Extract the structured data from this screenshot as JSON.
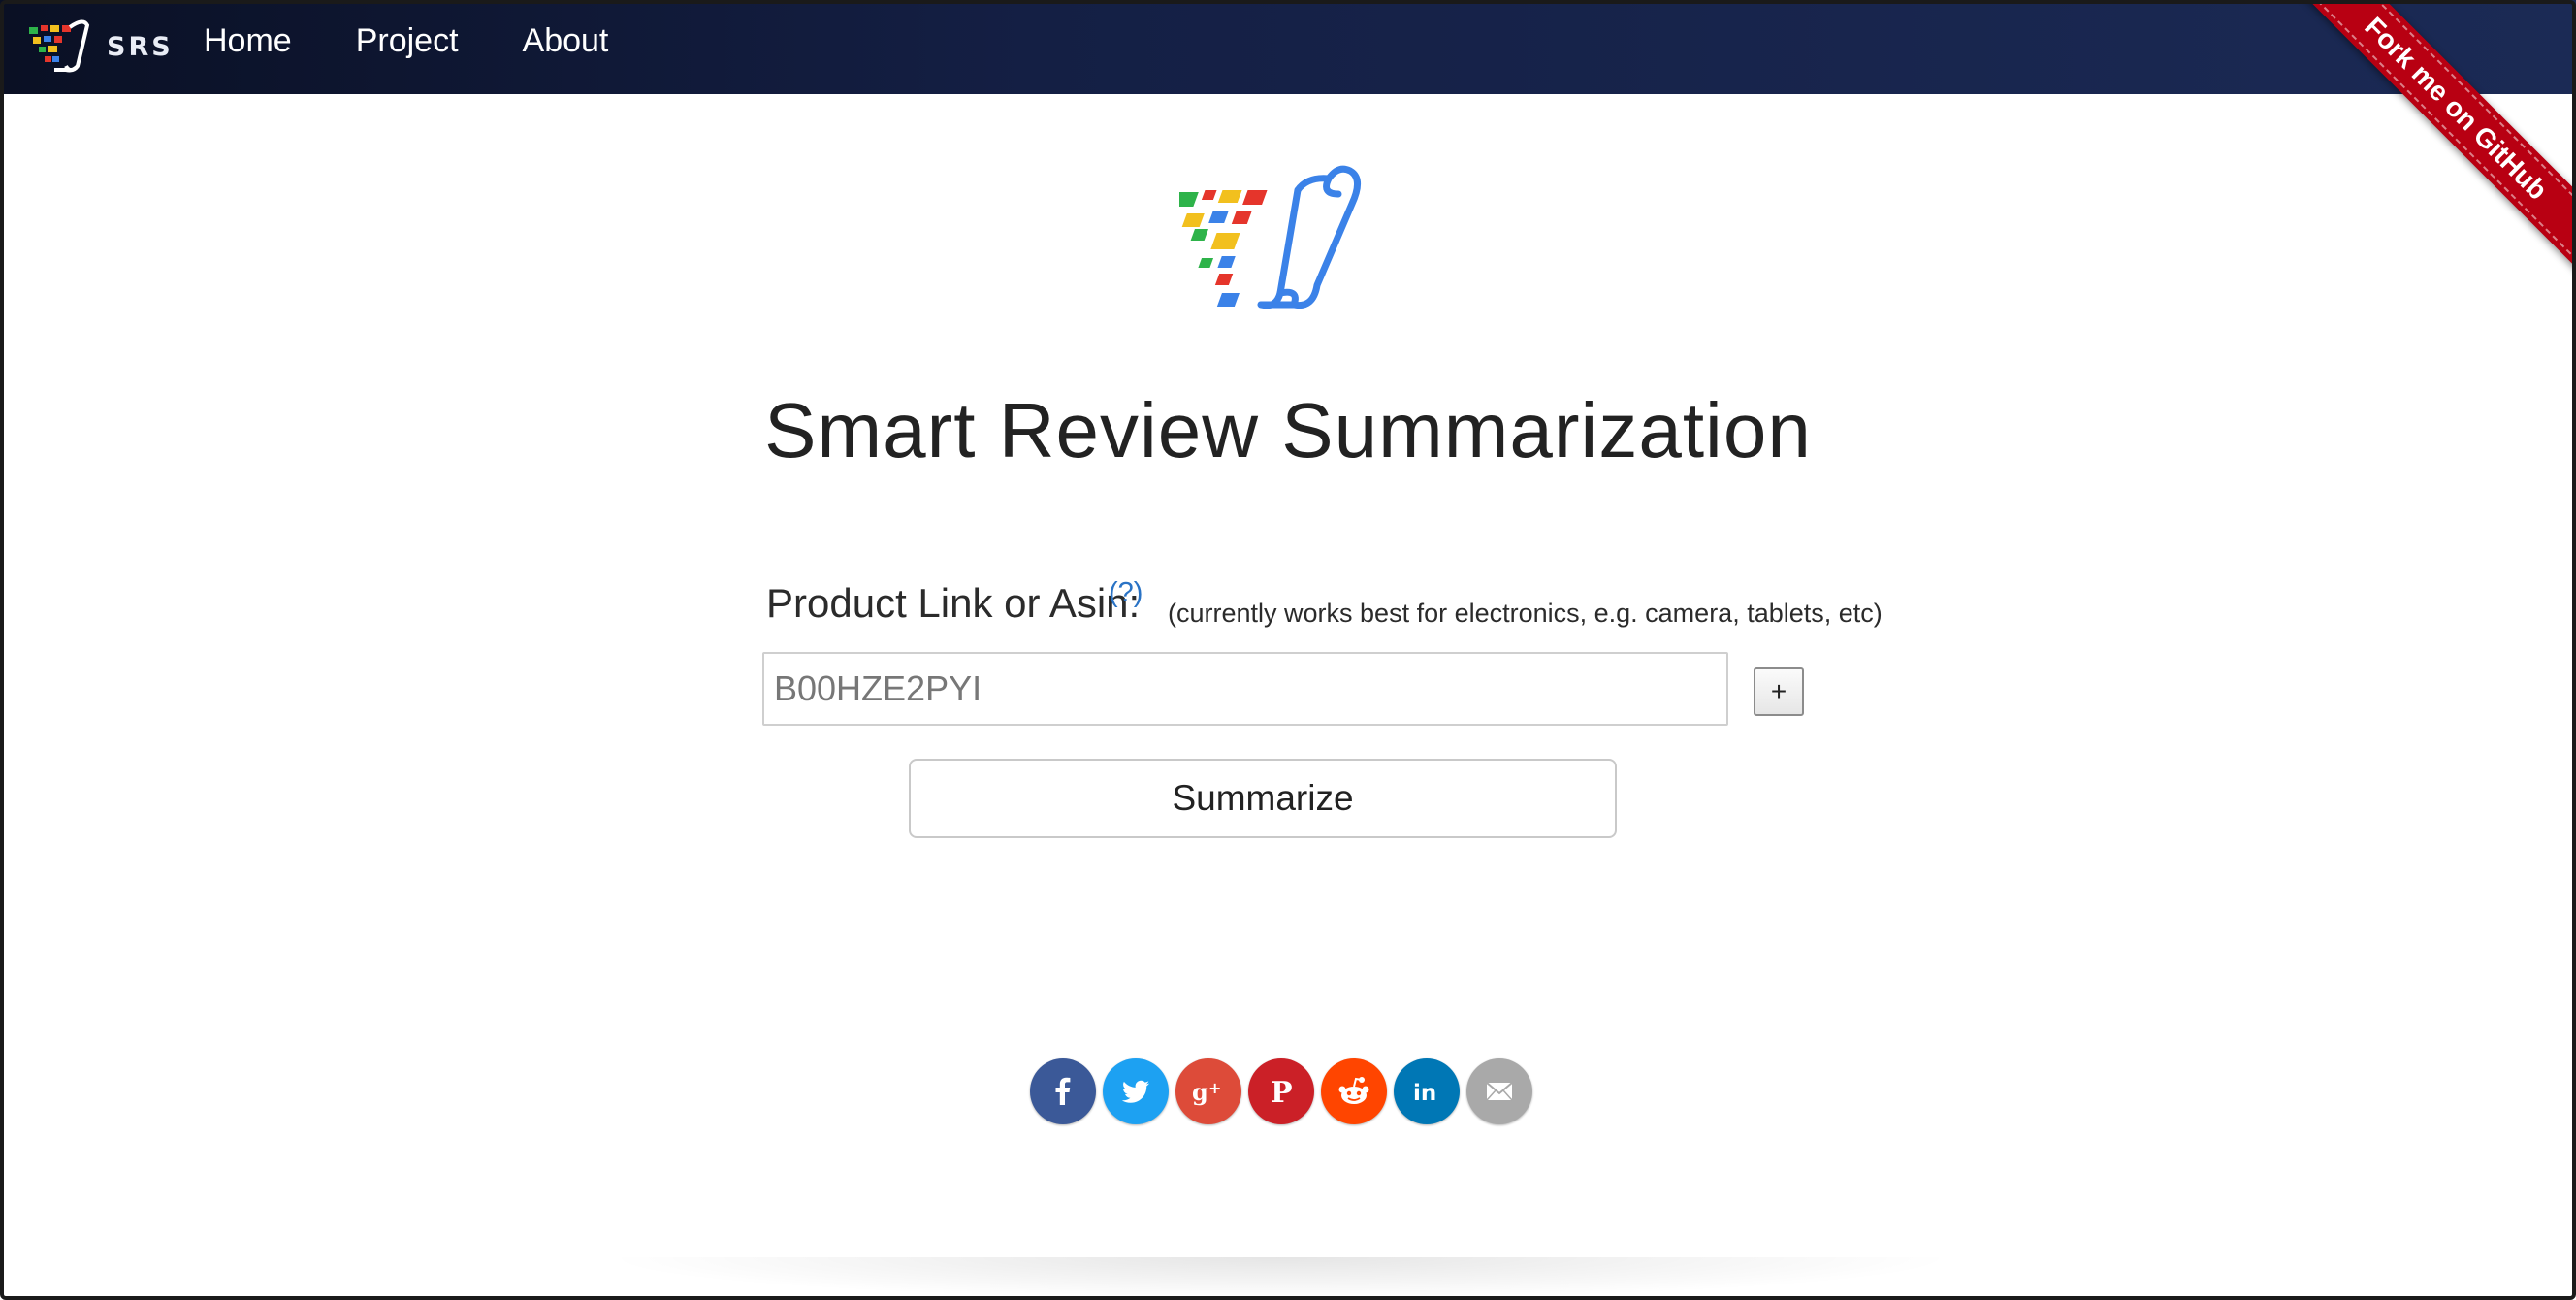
{
  "nav": {
    "brand": "SRS",
    "links": [
      "Home",
      "Project",
      "About"
    ]
  },
  "ribbon": {
    "text": "Fork me on GitHub"
  },
  "main": {
    "title": "Smart Review Summarization",
    "product_label": "Product Link or Asin:",
    "help": "(?)",
    "hint": "(currently works best for electronics, e.g. camera, tablets, etc)",
    "input_value": "B00HZE2PYI",
    "plus_label": "+",
    "summarize_label": "Summarize"
  },
  "social": [
    {
      "name": "facebook-icon",
      "color": "#3b5998"
    },
    {
      "name": "twitter-icon",
      "color": "#1da1f2"
    },
    {
      "name": "google-plus-icon",
      "color": "#dd4b39"
    },
    {
      "name": "pinterest-icon",
      "color": "#cb2027"
    },
    {
      "name": "reddit-icon",
      "color": "#ff4500"
    },
    {
      "name": "linkedin-icon",
      "color": "#0077b5"
    },
    {
      "name": "email-icon",
      "color": "#a9a9a9"
    }
  ],
  "colors": {
    "navbar": "#141f44",
    "ribbon": "#b80012",
    "logo_blue": "#3b82e8",
    "logo_green": "#2eb34a",
    "logo_yellow": "#f2c01e",
    "logo_red": "#e5352b"
  }
}
